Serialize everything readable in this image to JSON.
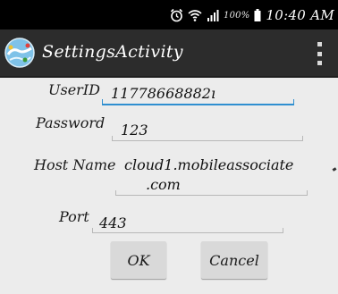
{
  "status_bar": {
    "icons": [
      "alarm-icon",
      "wifi-icon",
      "signal-icon",
      "battery-icon"
    ],
    "battery_percent": "100%",
    "time": "10:40 AM"
  },
  "action_bar": {
    "title": "SettingsActivity",
    "icon": "app-globe-icon",
    "menu_icon": "overflow-menu-icon"
  },
  "form": {
    "userid": {
      "label": "UserID",
      "value": "11778668882ı"
    },
    "password": {
      "label": "Password",
      "value": "123"
    },
    "host": {
      "label": "Host Name",
      "value_line1": "cloud1.mobileassociate",
      "value_line2": ".com"
    },
    "port": {
      "label": "Port",
      "value": "443"
    }
  },
  "buttons": {
    "ok": "OK",
    "cancel": "Cancel"
  },
  "colors": {
    "status_bar": "#000000",
    "action_bar": "#2c2c2c",
    "background": "#ececec",
    "focus_underline": "#2f8fd0",
    "underline": "#b8b8b8",
    "button": "#d9d9d9"
  }
}
